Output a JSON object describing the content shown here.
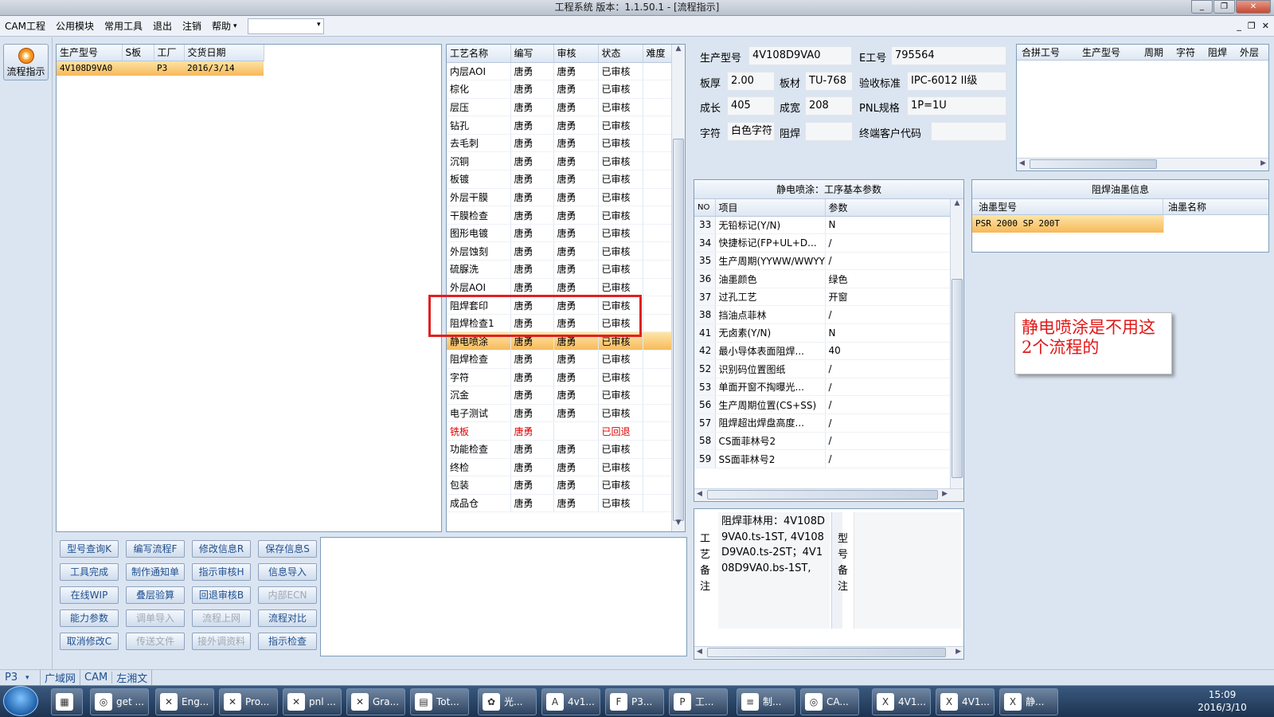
{
  "window": {
    "title": "工程系统   版本：1.1.50.1 - [流程指示]"
  },
  "menu": {
    "items": [
      "CAM工程",
      "公用模块",
      "常用工具",
      "退出",
      "注销",
      "帮助"
    ],
    "mdi": [
      "_",
      "❐",
      "✕"
    ]
  },
  "sidebar": {
    "flow_button": "流程指示"
  },
  "orders": {
    "headers": [
      "生产型号",
      "S板",
      "工厂",
      "交货日期"
    ],
    "rows": [
      [
        "4V108D9VA0",
        "",
        "P3",
        "2016/3/14"
      ]
    ]
  },
  "process": {
    "headers": [
      "工艺名称",
      "编写",
      "审核",
      "状态",
      "难度"
    ],
    "rows": [
      [
        "内层AOI",
        "唐勇",
        "唐勇",
        "已审核",
        ""
      ],
      [
        "棕化",
        "唐勇",
        "唐勇",
        "已审核",
        ""
      ],
      [
        "层压",
        "唐勇",
        "唐勇",
        "已审核",
        ""
      ],
      [
        "钻孔",
        "唐勇",
        "唐勇",
        "已审核",
        ""
      ],
      [
        "去毛刺",
        "唐勇",
        "唐勇",
        "已审核",
        ""
      ],
      [
        "沉铜",
        "唐勇",
        "唐勇",
        "已审核",
        ""
      ],
      [
        "板镀",
        "唐勇",
        "唐勇",
        "已审核",
        ""
      ],
      [
        "外层干膜",
        "唐勇",
        "唐勇",
        "已审核",
        ""
      ],
      [
        "干膜检查",
        "唐勇",
        "唐勇",
        "已审核",
        ""
      ],
      [
        "图形电镀",
        "唐勇",
        "唐勇",
        "已审核",
        ""
      ],
      [
        "外层蚀刻",
        "唐勇",
        "唐勇",
        "已审核",
        ""
      ],
      [
        "硫脲洗",
        "唐勇",
        "唐勇",
        "已审核",
        ""
      ],
      [
        "外层AOI",
        "唐勇",
        "唐勇",
        "已审核",
        ""
      ],
      [
        "阻焊套印",
        "唐勇",
        "唐勇",
        "已审核",
        ""
      ],
      [
        "阻焊检查1",
        "唐勇",
        "唐勇",
        "已审核",
        ""
      ],
      [
        "静电喷涂",
        "唐勇",
        "唐勇",
        "已审核",
        ""
      ],
      [
        "阻焊检查",
        "唐勇",
        "唐勇",
        "已审核",
        ""
      ],
      [
        "字符",
        "唐勇",
        "唐勇",
        "已审核",
        ""
      ],
      [
        "沉金",
        "唐勇",
        "唐勇",
        "已审核",
        ""
      ],
      [
        "电子测试",
        "唐勇",
        "唐勇",
        "已审核",
        ""
      ],
      [
        "铣板",
        "唐勇",
        "",
        "已回退",
        ""
      ],
      [
        "功能检查",
        "唐勇",
        "唐勇",
        "已审核",
        ""
      ],
      [
        "终检",
        "唐勇",
        "唐勇",
        "已审核",
        ""
      ],
      [
        "包装",
        "唐勇",
        "唐勇",
        "已审核",
        ""
      ],
      [
        "成品仓",
        "唐勇",
        "唐勇",
        "已审核",
        ""
      ]
    ],
    "selected_index": 15,
    "returned_index": 20
  },
  "info": {
    "labels": {
      "model": "生产型号",
      "eno": "E工号",
      "thick": "板厚",
      "mat": "板材",
      "std": "验收标准",
      "len": "成长",
      "wid": "成宽",
      "pnl": "PNL规格",
      "char": "字符",
      "mask": "阻焊",
      "cust": "终端客户代码"
    },
    "values": {
      "model": "4V108D9VA0",
      "eno": "795564",
      "thick": "2.00",
      "mat": "TU-768",
      "std": "IPC-6012 II级",
      "len": "405",
      "wid": "208",
      "pnl": "1P=1U",
      "char": "白色字符",
      "mask": "",
      "cust": ""
    }
  },
  "combine": {
    "headers": [
      "合拼工号",
      "生产型号",
      "周期",
      "字符",
      "阻焊",
      "外层"
    ]
  },
  "params": {
    "title": "静电喷涂：工序基本参数",
    "headers": [
      "NO",
      "项目",
      "参数"
    ],
    "rows": [
      [
        "33",
        "无铅标记(Y/N)",
        "N"
      ],
      [
        "34",
        "快捷标记(FP+UL+D...",
        "/"
      ],
      [
        "35",
        "生产周期(YYWW/WWYY)",
        "/"
      ],
      [
        "36",
        "油墨颜色",
        "绿色"
      ],
      [
        "37",
        "过孔工艺",
        "开窗"
      ],
      [
        "38",
        "挡油点菲林",
        "/"
      ],
      [
        "41",
        "无卤素(Y/N)",
        "N"
      ],
      [
        "42",
        "最小导体表面阻焊...",
        "40"
      ],
      [
        "52",
        "识别码位置图纸",
        "/"
      ],
      [
        "53",
        "单面开窗不掏曝光...",
        "/"
      ],
      [
        "56",
        "生产周期位置(CS+SS)",
        "/"
      ],
      [
        "57",
        "阻焊超出焊盘高度...",
        "/"
      ],
      [
        "58",
        "CS面菲林号2",
        "/"
      ],
      [
        "59",
        "SS面菲林号2",
        "/"
      ]
    ]
  },
  "ink": {
    "title": "阻焊油墨信息",
    "headers": [
      "油墨型号",
      "油墨名称"
    ],
    "rows": [
      [
        "PSR 2000 SP 200T",
        ""
      ]
    ]
  },
  "annotation": {
    "text": "静电喷涂是不用这2个流程的"
  },
  "remarks": {
    "process_label": "工艺备注",
    "process_text": "阻焊菲林用：4V108D9VA0.ts-1ST, 4V108D9VA0.ts-2ST；4V108D9VA0.bs-1ST,",
    "model_label": "型号备注",
    "model_text": ""
  },
  "buttons": [
    [
      "型号查询K",
      "编写流程F",
      "修改信息R",
      "保存信息S"
    ],
    [
      "工具完成",
      "制作通知单",
      "指示审核H",
      "信息导入"
    ],
    [
      "在线WIP",
      "叠层验算",
      "回退审核B",
      "内部ECN"
    ],
    [
      "能力参数",
      "调单导入",
      "流程上网",
      "流程对比"
    ],
    [
      "取消修改C",
      "传送文件",
      "接外调资料",
      "指示检查"
    ]
  ],
  "disabled_buttons": [
    "内部ECN",
    "调单导入",
    "流程上网",
    "传送文件",
    "接外调资料"
  ],
  "status": {
    "factory": "P3",
    "items": [
      "广域网",
      "CAM",
      "左湘文"
    ]
  },
  "taskbar": {
    "items": [
      "get ...",
      "Eng...",
      "Pro...",
      "pnl ...",
      "Gra...",
      "Tot...",
      "光...",
      "4v1...",
      "P3...",
      "工...",
      "制...",
      "CA...",
      "4V1...",
      "4V1...",
      "静..."
    ],
    "time": "15:09",
    "date": "2016/3/10"
  },
  "colors": {
    "accent": "#e01818",
    "selection": "#f7b85a",
    "highlight_box": "#e02020"
  }
}
